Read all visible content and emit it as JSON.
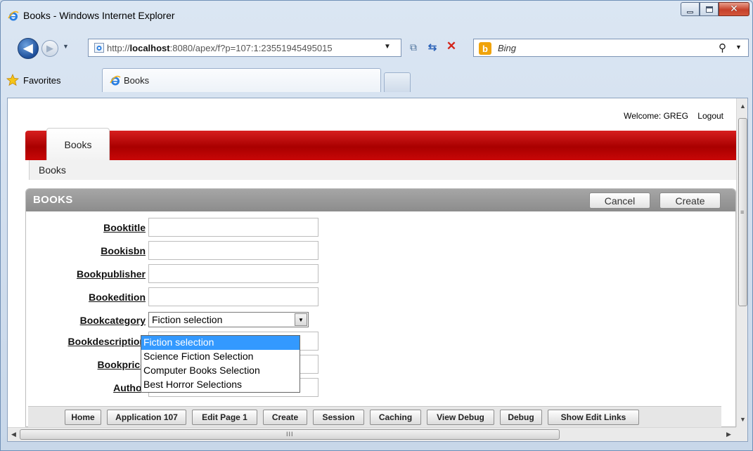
{
  "window": {
    "title": "Books - Windows Internet Explorer"
  },
  "address_bar": {
    "url_prefix": "http://",
    "url_host": "localhost",
    "url_rest": ":8080/apex/f?p=107:1:23551945495015",
    "search_placeholder": "Bing"
  },
  "favorites_bar": {
    "favorites_label": "Favorites",
    "tab_label": "Books"
  },
  "page": {
    "welcome_text": "Welcome: GREG",
    "logout_label": "Logout",
    "main_tab": "Books",
    "breadcrumb": "Books",
    "region": {
      "title": "BOOKS",
      "cancel_label": "Cancel",
      "create_label": "Create"
    },
    "form": {
      "fields": [
        {
          "label": "Booktitle",
          "value": ""
        },
        {
          "label": "Bookisbn",
          "value": ""
        },
        {
          "label": "Bookpublisher",
          "value": ""
        },
        {
          "label": "Bookedition",
          "value": ""
        },
        {
          "label": "Bookcategory",
          "value": "Fiction selection"
        },
        {
          "label": "Bookdescription",
          "value": ""
        },
        {
          "label": "Bookprice",
          "value": ""
        },
        {
          "label": "Author",
          "value": ""
        }
      ],
      "partially_hidden_label": "Bo",
      "category_options": [
        "Fiction selection",
        "Science Fiction Selection",
        "Computer Books Selection",
        "Best Horror Selections"
      ]
    },
    "dev_toolbar": [
      "Home",
      "Application 107",
      "Edit Page 1",
      "Create",
      "Session",
      "Caching",
      "View Debug",
      "Debug",
      "Show Edit Links"
    ]
  },
  "icons": {
    "ie": "ie-logo-icon",
    "star": "favorites-star-icon",
    "bing": "bing-icon"
  },
  "colors": {
    "brand_red": "#b40000",
    "region_header": "#999999",
    "selection_blue": "#3399ff"
  }
}
